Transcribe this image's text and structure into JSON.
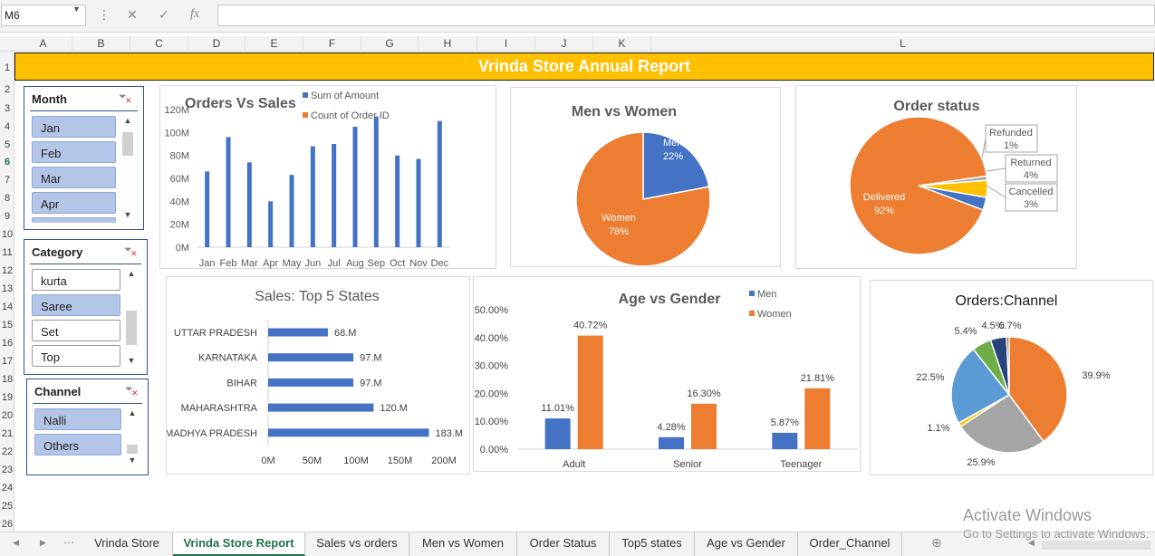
{
  "formula_bar": {
    "name_box": "M6",
    "cancel_icon": "✕",
    "enter_icon": "✓",
    "fx_icon": "fx",
    "dots": "⋮"
  },
  "columns": [
    "A",
    "B",
    "C",
    "D",
    "E",
    "F",
    "G",
    "H",
    "I",
    "J",
    "K",
    "L"
  ],
  "rows": [
    "1",
    "2",
    "3",
    "4",
    "5",
    "6",
    "7",
    "8",
    "9",
    "10",
    "11",
    "12",
    "13",
    "14",
    "15",
    "16",
    "17",
    "18",
    "19",
    "20",
    "21",
    "22",
    "23",
    "24",
    "25",
    "26"
  ],
  "selected_row": "6",
  "report_title": "Vrinda Store Annual Report",
  "slicers": {
    "month": {
      "title": "Month",
      "items": [
        "Jan",
        "Feb",
        "Mar",
        "Apr"
      ]
    },
    "category": {
      "title": "Category",
      "items": [
        "kurta",
        "Saree",
        "Set",
        "Top"
      ]
    },
    "channel": {
      "title": "Channel",
      "items": [
        "Nalli",
        "Others"
      ]
    }
  },
  "tabs": [
    "Vrinda Store",
    "Vrinda Store Report",
    "Sales vs orders",
    "Men vs Women",
    "Order Status",
    "Top5 states",
    "Age vs Gender",
    "Order_Channel"
  ],
  "active_tab": "Vrinda Store Report",
  "watermark": {
    "line1": "Activate Windows",
    "line2": "Go to Settings to activate Windows."
  },
  "colors": {
    "blue": "#4472c4",
    "orange": "#ed7d31",
    "gray": "#a5a5a5",
    "yellow": "#ffc000",
    "lightblue": "#5b9bd5",
    "green": "#70ad47",
    "navy": "#264478"
  },
  "chart_data": [
    {
      "id": "orders-vs-sales",
      "type": "bar",
      "title": "Orders Vs Sales",
      "legend": [
        "Sum of Amount",
        "Count of Order ID"
      ],
      "categories": [
        "Jan",
        "Feb",
        "Mar",
        "Apr",
        "May",
        "Jun",
        "Jul",
        "Aug",
        "Sep",
        "Oct",
        "Nov",
        "Dec"
      ],
      "series": [
        {
          "name": "Sum of Amount",
          "values": [
            66,
            96,
            74,
            40,
            63,
            88,
            90,
            105,
            114,
            80,
            77,
            110
          ]
        }
      ],
      "yticks": [
        "0M",
        "20M",
        "40M",
        "60M",
        "80M",
        "100M",
        "120M"
      ],
      "ylim": [
        0,
        120
      ]
    },
    {
      "id": "men-vs-women",
      "type": "pie",
      "title": "Men vs Women",
      "labels": [
        "Men",
        "Women"
      ],
      "values": [
        22,
        78
      ],
      "value_labels": [
        "22%",
        "78%"
      ]
    },
    {
      "id": "order-status",
      "type": "pie",
      "title": "Order status",
      "labels": [
        "Delivered",
        "Refunded",
        "Returned",
        "Cancelled"
      ],
      "values": [
        92,
        1,
        4,
        3
      ],
      "value_labels": [
        "92%",
        "1%",
        "4%",
        "3%"
      ]
    },
    {
      "id": "top5-states",
      "type": "bar",
      "title": "Sales: Top 5 States",
      "categories": [
        "UTTAR PRADESH",
        "KARNATAKA",
        "BIHAR",
        "MAHARASHTRA",
        "MADHYA PRADESH"
      ],
      "values": [
        68,
        97,
        97,
        120,
        183
      ],
      "value_labels": [
        "68.M",
        "97.M",
        "97.M",
        "120.M",
        "183.M"
      ],
      "xticks": [
        "0M",
        "50M",
        "100M",
        "150M",
        "200M"
      ],
      "xlim": [
        0,
        200
      ]
    },
    {
      "id": "age-vs-gender",
      "type": "bar",
      "title": "Age vs Gender",
      "categories": [
        "Adult",
        "Senior",
        "Teenager"
      ],
      "series": [
        {
          "name": "Men",
          "values": [
            11.01,
            4.28,
            5.87
          ],
          "labels": [
            "11.01%",
            "4.28%",
            "5.87%"
          ]
        },
        {
          "name": "Women",
          "values": [
            40.72,
            16.3,
            21.81
          ],
          "labels": [
            "40.72%",
            "16.30%",
            "21.81%"
          ]
        }
      ],
      "yticks": [
        "0.00%",
        "10.00%",
        "20.00%",
        "30.00%",
        "40.00%",
        "50.00%"
      ],
      "ylim": [
        0,
        50
      ]
    },
    {
      "id": "orders-channel",
      "type": "pie",
      "title": "Orders:Channel",
      "values": [
        39.9,
        25.9,
        1.1,
        22.5,
        5.4,
        4.5,
        0.7
      ],
      "value_labels": [
        "39.9%",
        "25.9%",
        "1.1%",
        "22.5%",
        "5.4%",
        "4.5%",
        "0.7%"
      ]
    }
  ]
}
